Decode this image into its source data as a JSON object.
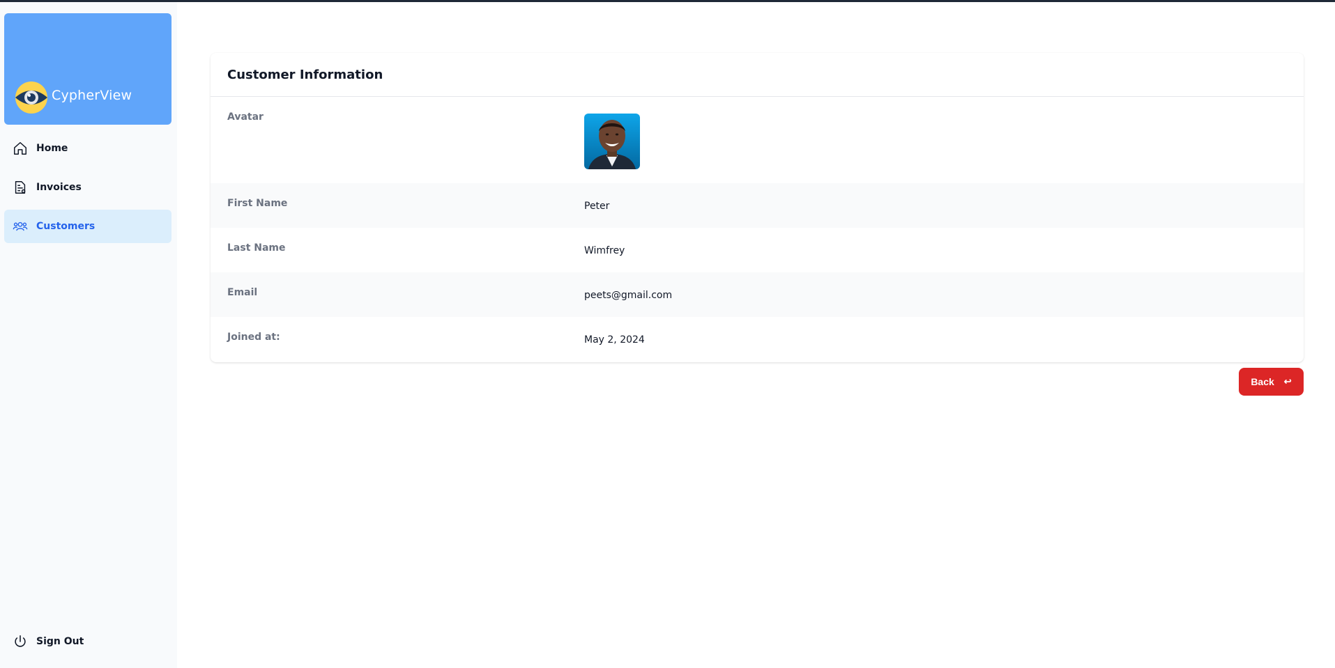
{
  "brand": {
    "name": "CypherView",
    "logo_icon": "eye-icon",
    "color": "#60a5fa"
  },
  "sidebar": {
    "items": [
      {
        "label": "Home",
        "icon": "home-icon",
        "active": false
      },
      {
        "label": "Invoices",
        "icon": "invoice-icon",
        "active": false
      },
      {
        "label": "Customers",
        "icon": "users-icon",
        "active": true
      }
    ],
    "signout": {
      "label": "Sign Out",
      "icon": "power-icon"
    }
  },
  "card": {
    "title": "Customer Information",
    "rows": [
      {
        "label": "Avatar",
        "value": ""
      },
      {
        "label": "First Name",
        "value": "Peter"
      },
      {
        "label": "Last Name",
        "value": "Wimfrey"
      },
      {
        "label": "Email",
        "value": "peets@gmail.com"
      },
      {
        "label": "Joined at:",
        "value": "May 2, 2024"
      }
    ]
  },
  "back_button": {
    "label": "Back",
    "icon": "return-arrow-icon",
    "color": "#dc2626"
  }
}
